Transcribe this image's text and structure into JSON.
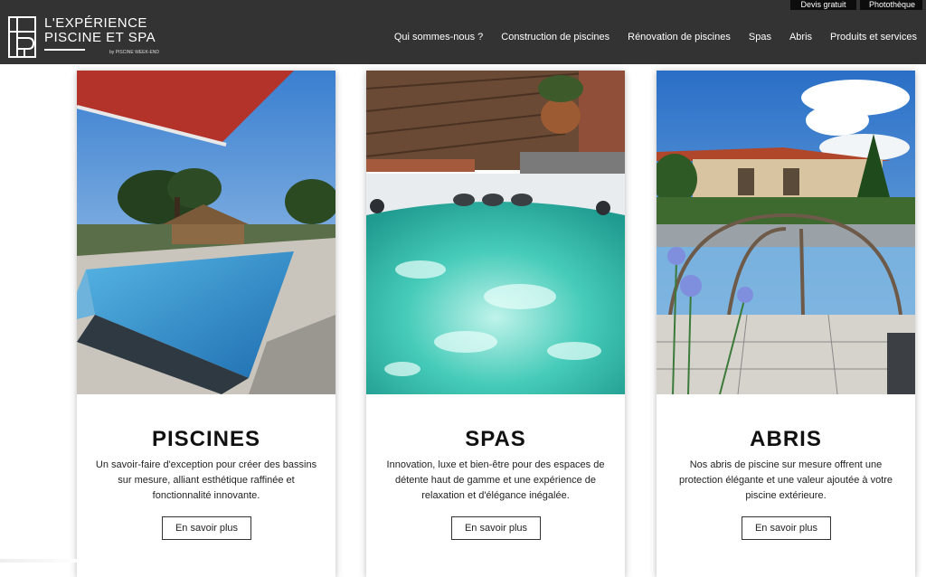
{
  "header": {
    "logo": {
      "line1": "L'EXPÉRIENCE",
      "line2": "PISCINE ET SPA",
      "byline": "by PISCINE WEEK-END"
    },
    "top_links": [
      "Devis gratuit",
      "Photothèque"
    ],
    "nav": [
      "Qui sommes-nous ?",
      "Construction de piscines",
      "Rénovation de piscines",
      "Spas",
      "Abris",
      "Produits et services"
    ]
  },
  "cards": [
    {
      "title": "PISCINES",
      "text": "Un savoir-faire d'exception pour créer des bassins sur mesure, alliant esthétique raffinée et fonctionnalité innovante.",
      "button": "En savoir plus"
    },
    {
      "title": "SPAS",
      "text": "Innovation, luxe et bien-être pour des espaces de détente haut de gamme et une expérience de relaxation et d'élégance inégalée.",
      "button": "En savoir plus"
    },
    {
      "title": "ABRIS",
      "text": "Nos abris de piscine sur mesure offrent une protection élégante et une valeur ajoutée à votre piscine extérieure.",
      "button": "En savoir plus"
    }
  ],
  "colors": {
    "header_bg": "#333333",
    "top_link_bg": "#0d0d0d",
    "pool_blue": "#2d8fc9",
    "spa_turquoise": "#3cc8b8"
  }
}
